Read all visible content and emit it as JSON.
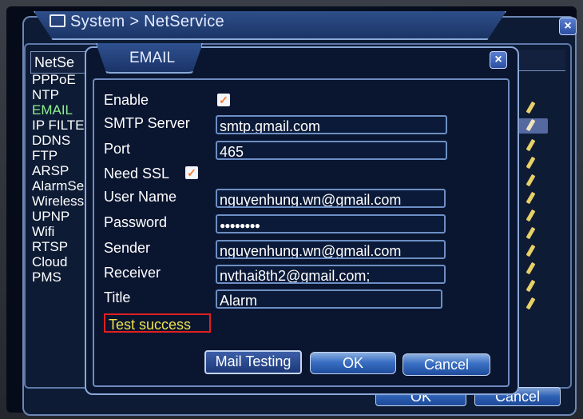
{
  "outer": {
    "title": "System > NetService",
    "close": "×",
    "list_header": "NetSe",
    "items": [
      "PPPoE",
      "NTP",
      "EMAIL",
      "IP FILTER",
      "DDNS",
      "FTP",
      "ARSP",
      "AlarmServer",
      "Wireless",
      "UPNP",
      "Wifi",
      "RTSP",
      "Cloud",
      "PMS"
    ],
    "ok": "OK",
    "cancel": "Cancel"
  },
  "email": {
    "title": "EMAIL",
    "close": "×",
    "enable_label": "Enable",
    "enable_checked": "✓",
    "smtp_label": "SMTP Server",
    "smtp_value": "smtp.gmail.com",
    "port_label": "Port",
    "port_value": "465",
    "ssl_label": "Need SSL",
    "ssl_checked": "✓",
    "user_label": "User Name",
    "user_value": "nguyenhung.wn@gmail.com",
    "password_label": "Password",
    "password_value": "●●●●●●●●",
    "sender_label": "Sender",
    "sender_value": "nguyenhung.wn@gmail.com",
    "receiver_label": "Receiver",
    "receiver_value": "nvthai8th2@gmail.com;",
    "title_label": "Title",
    "title_value": "Alarm",
    "status": "Test success",
    "mail_testing": "Mail Testing",
    "ok": "OK",
    "cancel": "Cancel"
  },
  "colors": {
    "active_item": "#8ff08f",
    "status_text": "#f1e14a",
    "status_border": "#e02020",
    "checkmark": "#ff7a2a"
  }
}
